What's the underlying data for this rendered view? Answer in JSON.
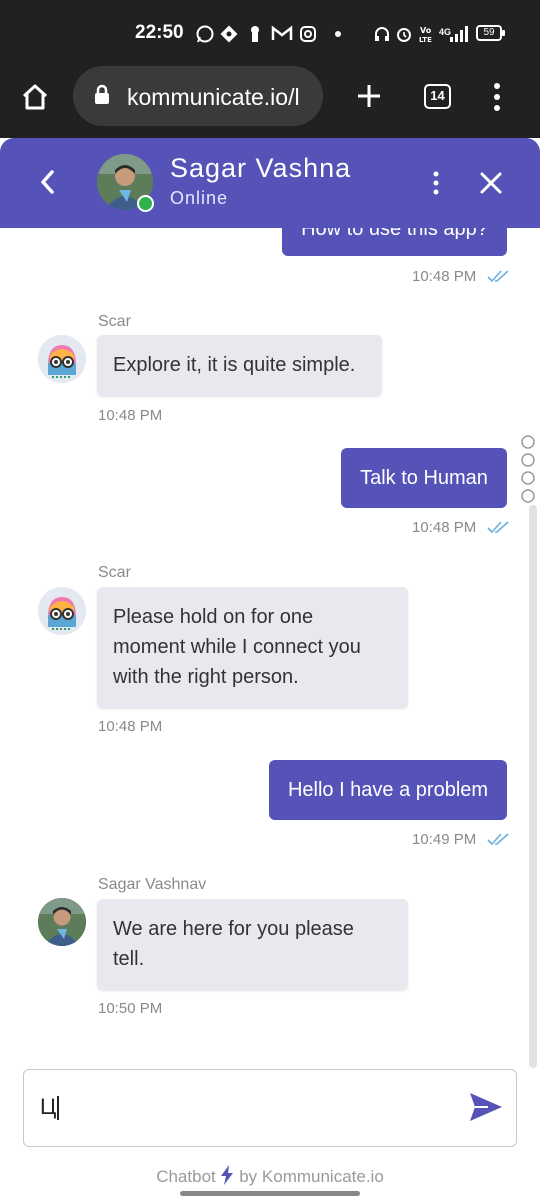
{
  "status_bar": {
    "time": "22:50",
    "battery": "59",
    "network": "4G"
  },
  "browser": {
    "url": "kommunicate.io/l",
    "tab_count": "14"
  },
  "chat_header": {
    "name": "Sagar Vashna",
    "status": "Online",
    "accent": "#5553b7",
    "online_color": "#2fb24c"
  },
  "messages": [
    {
      "direction": "out",
      "text": "How to use this app?",
      "time": "10:48 PM"
    },
    {
      "direction": "in",
      "sender": "Scar",
      "text": "Explore it, it is quite simple.",
      "time": "10:48 PM"
    },
    {
      "direction": "out",
      "text": "Talk to Human",
      "time": "10:48 PM"
    },
    {
      "direction": "in",
      "sender": "Scar",
      "lines": [
        "Please hold on for one",
        "moment while I connect you",
        "with the right person."
      ],
      "time": "10:48 PM"
    },
    {
      "direction": "out",
      "text": "Hello I have a problem",
      "time": "10:49 PM"
    },
    {
      "direction": "in",
      "sender": "Sagar Vashnav",
      "lines": [
        "We are here for you please",
        "tell."
      ],
      "time": "10:50 PM"
    }
  ],
  "composer": {
    "value": "Ц"
  },
  "footer": {
    "prefix": "Chatbot",
    "suffix": "by Kommunicate.io"
  }
}
